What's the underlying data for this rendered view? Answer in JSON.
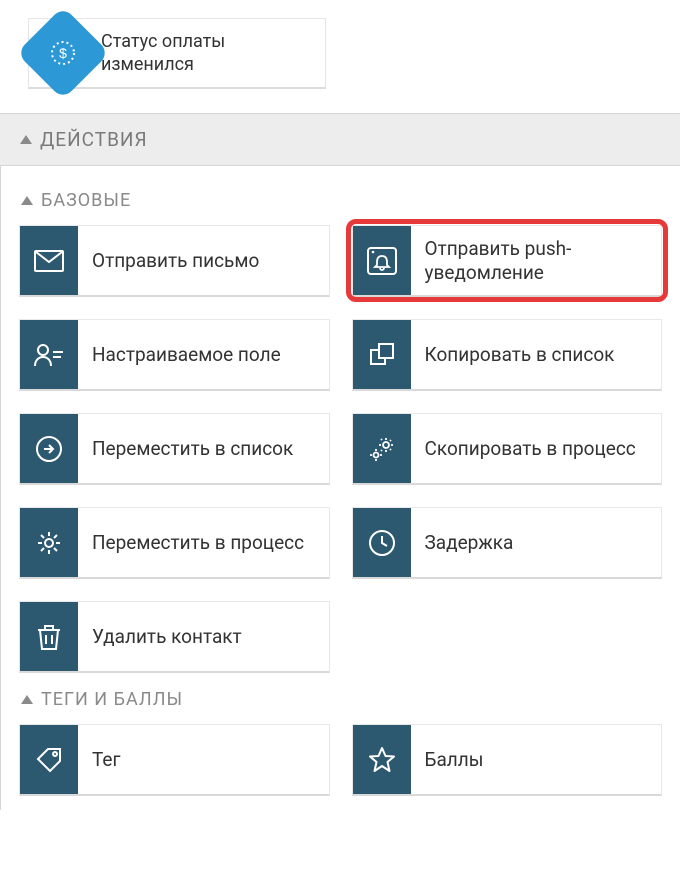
{
  "event": {
    "label": "Статус оплаты изменился"
  },
  "section": {
    "title": "ДЕЙСТВИЯ"
  },
  "groups": [
    {
      "title": "БАЗОВЫЕ",
      "items": [
        {
          "label": "Отправить письмо"
        },
        {
          "label": "Отправить push-уведомление"
        },
        {
          "label": "Настраиваемое поле"
        },
        {
          "label": "Копировать в список"
        },
        {
          "label": "Переместить в список"
        },
        {
          "label": "Скопировать в процесс"
        },
        {
          "label": "Переместить в процесс"
        },
        {
          "label": "Задержка"
        },
        {
          "label": "Удалить контакт"
        }
      ]
    },
    {
      "title": "ТЕГИ И БАЛЛЫ",
      "items": [
        {
          "label": "Тег"
        },
        {
          "label": "Баллы"
        }
      ]
    }
  ],
  "colors": {
    "tile_icon_bg": "#2d5970",
    "highlight_border": "#e63a3a",
    "event_icon": "#2d98d6"
  }
}
